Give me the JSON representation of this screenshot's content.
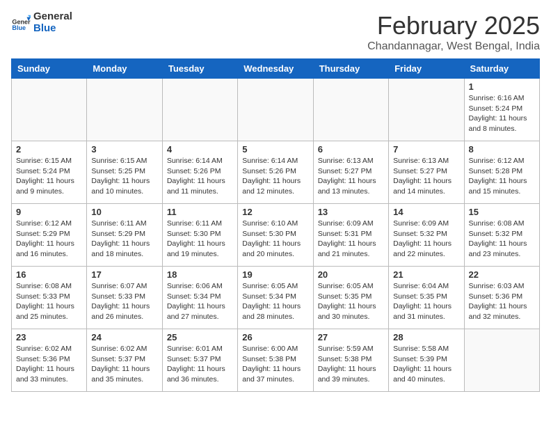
{
  "header": {
    "logo_line1": "General",
    "logo_line2": "Blue",
    "month_year": "February 2025",
    "location": "Chandannagar, West Bengal, India"
  },
  "weekdays": [
    "Sunday",
    "Monday",
    "Tuesday",
    "Wednesday",
    "Thursday",
    "Friday",
    "Saturday"
  ],
  "weeks": [
    [
      {
        "day": "",
        "info": ""
      },
      {
        "day": "",
        "info": ""
      },
      {
        "day": "",
        "info": ""
      },
      {
        "day": "",
        "info": ""
      },
      {
        "day": "",
        "info": ""
      },
      {
        "day": "",
        "info": ""
      },
      {
        "day": "1",
        "info": "Sunrise: 6:16 AM\nSunset: 5:24 PM\nDaylight: 11 hours and 8 minutes."
      }
    ],
    [
      {
        "day": "2",
        "info": "Sunrise: 6:15 AM\nSunset: 5:24 PM\nDaylight: 11 hours and 9 minutes."
      },
      {
        "day": "3",
        "info": "Sunrise: 6:15 AM\nSunset: 5:25 PM\nDaylight: 11 hours and 10 minutes."
      },
      {
        "day": "4",
        "info": "Sunrise: 6:14 AM\nSunset: 5:26 PM\nDaylight: 11 hours and 11 minutes."
      },
      {
        "day": "5",
        "info": "Sunrise: 6:14 AM\nSunset: 5:26 PM\nDaylight: 11 hours and 12 minutes."
      },
      {
        "day": "6",
        "info": "Sunrise: 6:13 AM\nSunset: 5:27 PM\nDaylight: 11 hours and 13 minutes."
      },
      {
        "day": "7",
        "info": "Sunrise: 6:13 AM\nSunset: 5:27 PM\nDaylight: 11 hours and 14 minutes."
      },
      {
        "day": "8",
        "info": "Sunrise: 6:12 AM\nSunset: 5:28 PM\nDaylight: 11 hours and 15 minutes."
      }
    ],
    [
      {
        "day": "9",
        "info": "Sunrise: 6:12 AM\nSunset: 5:29 PM\nDaylight: 11 hours and 16 minutes."
      },
      {
        "day": "10",
        "info": "Sunrise: 6:11 AM\nSunset: 5:29 PM\nDaylight: 11 hours and 18 minutes."
      },
      {
        "day": "11",
        "info": "Sunrise: 6:11 AM\nSunset: 5:30 PM\nDaylight: 11 hours and 19 minutes."
      },
      {
        "day": "12",
        "info": "Sunrise: 6:10 AM\nSunset: 5:30 PM\nDaylight: 11 hours and 20 minutes."
      },
      {
        "day": "13",
        "info": "Sunrise: 6:09 AM\nSunset: 5:31 PM\nDaylight: 11 hours and 21 minutes."
      },
      {
        "day": "14",
        "info": "Sunrise: 6:09 AM\nSunset: 5:32 PM\nDaylight: 11 hours and 22 minutes."
      },
      {
        "day": "15",
        "info": "Sunrise: 6:08 AM\nSunset: 5:32 PM\nDaylight: 11 hours and 23 minutes."
      }
    ],
    [
      {
        "day": "16",
        "info": "Sunrise: 6:08 AM\nSunset: 5:33 PM\nDaylight: 11 hours and 25 minutes."
      },
      {
        "day": "17",
        "info": "Sunrise: 6:07 AM\nSunset: 5:33 PM\nDaylight: 11 hours and 26 minutes."
      },
      {
        "day": "18",
        "info": "Sunrise: 6:06 AM\nSunset: 5:34 PM\nDaylight: 11 hours and 27 minutes."
      },
      {
        "day": "19",
        "info": "Sunrise: 6:05 AM\nSunset: 5:34 PM\nDaylight: 11 hours and 28 minutes."
      },
      {
        "day": "20",
        "info": "Sunrise: 6:05 AM\nSunset: 5:35 PM\nDaylight: 11 hours and 30 minutes."
      },
      {
        "day": "21",
        "info": "Sunrise: 6:04 AM\nSunset: 5:35 PM\nDaylight: 11 hours and 31 minutes."
      },
      {
        "day": "22",
        "info": "Sunrise: 6:03 AM\nSunset: 5:36 PM\nDaylight: 11 hours and 32 minutes."
      }
    ],
    [
      {
        "day": "23",
        "info": "Sunrise: 6:02 AM\nSunset: 5:36 PM\nDaylight: 11 hours and 33 minutes."
      },
      {
        "day": "24",
        "info": "Sunrise: 6:02 AM\nSunset: 5:37 PM\nDaylight: 11 hours and 35 minutes."
      },
      {
        "day": "25",
        "info": "Sunrise: 6:01 AM\nSunset: 5:37 PM\nDaylight: 11 hours and 36 minutes."
      },
      {
        "day": "26",
        "info": "Sunrise: 6:00 AM\nSunset: 5:38 PM\nDaylight: 11 hours and 37 minutes."
      },
      {
        "day": "27",
        "info": "Sunrise: 5:59 AM\nSunset: 5:38 PM\nDaylight: 11 hours and 39 minutes."
      },
      {
        "day": "28",
        "info": "Sunrise: 5:58 AM\nSunset: 5:39 PM\nDaylight: 11 hours and 40 minutes."
      },
      {
        "day": "",
        "info": ""
      }
    ]
  ]
}
